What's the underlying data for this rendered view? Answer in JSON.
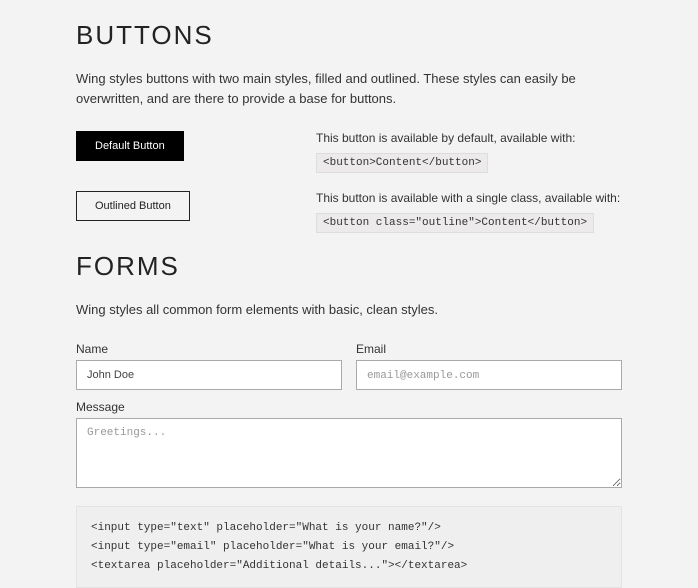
{
  "buttons": {
    "heading": "BUTTONS",
    "intro": "Wing styles buttons with two main styles, filled and outlined. These styles can easily be overwritten, and are there to provide a base for buttons.",
    "default": {
      "label": "Default Button",
      "desc": "This button is available by default, available with:",
      "code": "<button>Content</button>"
    },
    "outlined": {
      "label": "Outlined Button",
      "desc": "This button is available with a single class, available with:",
      "code": "<button class=\"outline\">Content</button>"
    }
  },
  "forms": {
    "heading": "FORMS",
    "intro": "Wing styles all common form elements with basic, clean styles.",
    "name": {
      "label": "Name",
      "value": "John Doe"
    },
    "email": {
      "label": "Email",
      "placeholder": "email@example.com"
    },
    "message": {
      "label": "Message",
      "placeholder": "Greetings..."
    },
    "codeblock": "<input type=\"text\" placeholder=\"What is your name?\"/>\n<input type=\"email\" placeholder=\"What is your email?\"/>\n<textarea placeholder=\"Additional details...\"></textarea>"
  }
}
